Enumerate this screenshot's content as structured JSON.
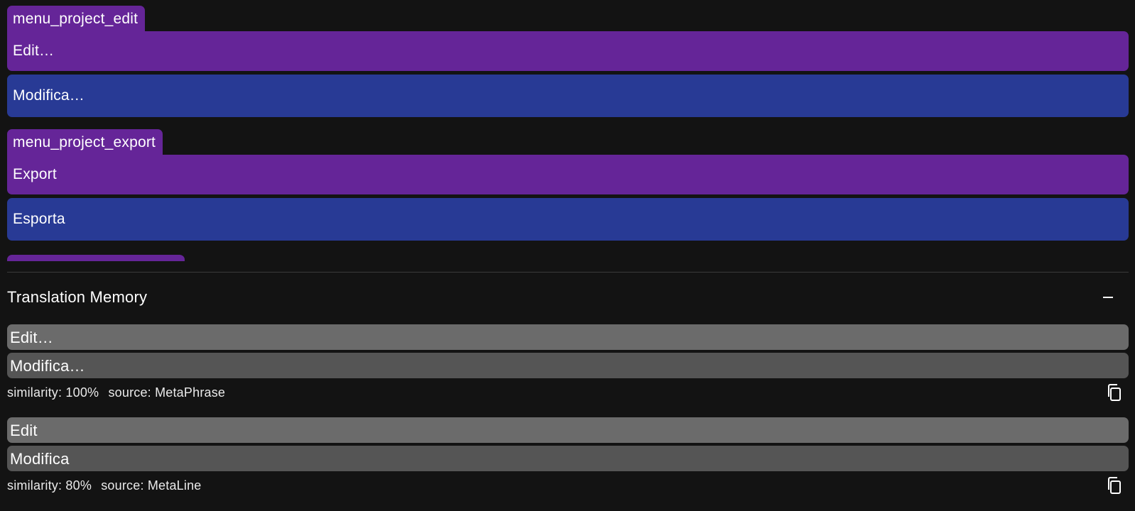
{
  "colors": {
    "key_tab": "#652598",
    "source_row": "#652598",
    "target_row": "#283a95",
    "background": "#131313"
  },
  "entries": [
    {
      "key": "menu_project_edit",
      "source": "Edit…",
      "target": "Modifica…"
    },
    {
      "key": "menu_project_export",
      "source": "Export",
      "target": "Esporta"
    }
  ],
  "translation_memory": {
    "title": "Translation Memory",
    "collapse_icon": "minus-icon",
    "items": [
      {
        "source": "Edit…",
        "target": "Modifica…",
        "similarity": "similarity: 100%",
        "origin": "source: MetaPhrase",
        "action_icon": "copy-icon"
      },
      {
        "source": "Edit",
        "target": "Modifica",
        "similarity": "similarity: 80%",
        "origin": "source: MetaLine",
        "action_icon": "copy-icon"
      }
    ]
  }
}
